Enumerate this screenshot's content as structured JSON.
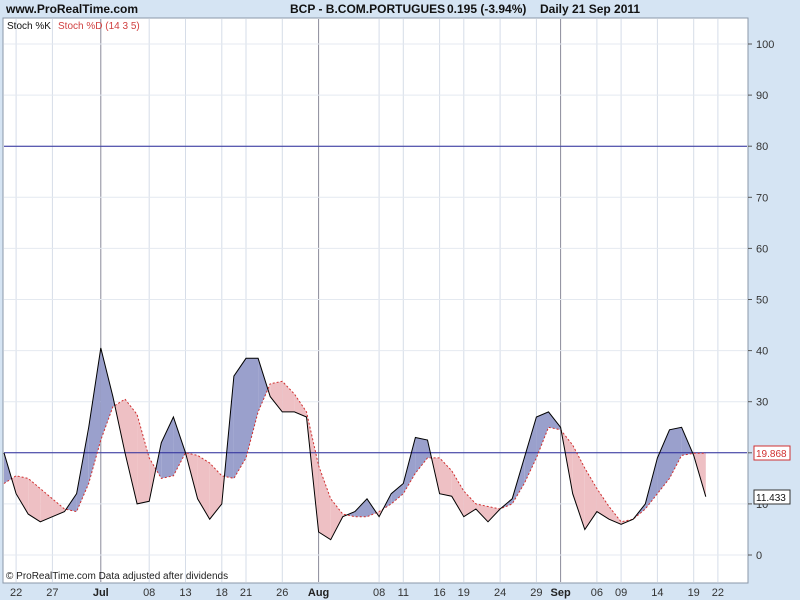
{
  "header": {
    "site": "www.ProRealTime.com",
    "ticker": "BCP - B.COM.PORTUGUES",
    "price": "0.195 (-3.94%)",
    "period": "Daily  21 Sep 2011"
  },
  "legend": {
    "k_label": "Stoch %K",
    "d_label": "Stoch %D (14 3 5)"
  },
  "footer": {
    "note": "© ProRealTime.com  Data adjusted after dividends"
  },
  "colors": {
    "k_line": "#000000",
    "d_line": "#d03030",
    "fill_up": "#9aa0cc",
    "fill_down": "#eec0c4",
    "ref_line": "#2a2a9a",
    "bg": "#ffffff",
    "frame": "#d5e4f3"
  },
  "chart_data": {
    "type": "line",
    "title": "BCP - B.COM.PORTUGUES",
    "ylim": [
      0,
      100
    ],
    "y_ticks": [
      "0",
      "10",
      "20",
      "30",
      "40",
      "50",
      "60",
      "70",
      "80",
      "90",
      "100"
    ],
    "reference_lines": [
      20,
      80
    ],
    "x_tick_labels": [
      "22",
      "27",
      "Jul",
      "08",
      "13",
      "18",
      "21",
      "26",
      "Aug",
      "08",
      "11",
      "16",
      "19",
      "24",
      "29",
      "Sep",
      "06",
      "09",
      "14",
      "19",
      "22"
    ],
    "month_labels": [
      "Jul",
      "Aug",
      "Sep"
    ],
    "last_values": {
      "d": "19.868",
      "k": "11.433"
    },
    "series": [
      {
        "name": "Stoch %K",
        "values": [
          20,
          12,
          8,
          6.5,
          7.5,
          8.5,
          12,
          25,
          40.5,
          31,
          20,
          10,
          10.5,
          22,
          27,
          20,
          11,
          7,
          10,
          35,
          38.5,
          38.5,
          31,
          28,
          28,
          27,
          4.5,
          3,
          7.5,
          8.5,
          11,
          7.5,
          12,
          14,
          23,
          22.5,
          12,
          11.5,
          7.5,
          9,
          6.5,
          9,
          11,
          19,
          27,
          28,
          25,
          12,
          5,
          8.5,
          7,
          6,
          7,
          10,
          19,
          24.5,
          25,
          19.5,
          11.4
        ]
      },
      {
        "name": "Stoch %D (14 3 5)",
        "values": [
          14,
          15.5,
          15,
          13,
          11,
          9,
          8.5,
          14,
          22.5,
          29,
          30.5,
          27.5,
          19,
          15,
          15.5,
          20,
          19.5,
          18,
          15.5,
          15,
          19,
          28,
          33.5,
          34,
          31.5,
          28,
          17.5,
          11,
          8,
          7.5,
          7.5,
          8.5,
          10,
          12,
          16,
          19,
          19,
          16.5,
          12.5,
          10,
          9.5,
          9,
          10,
          14,
          19,
          25,
          24.5,
          21.5,
          17,
          13,
          9.5,
          6.5,
          7,
          9,
          12,
          15,
          19.5,
          19.9,
          19.9
        ]
      }
    ]
  }
}
